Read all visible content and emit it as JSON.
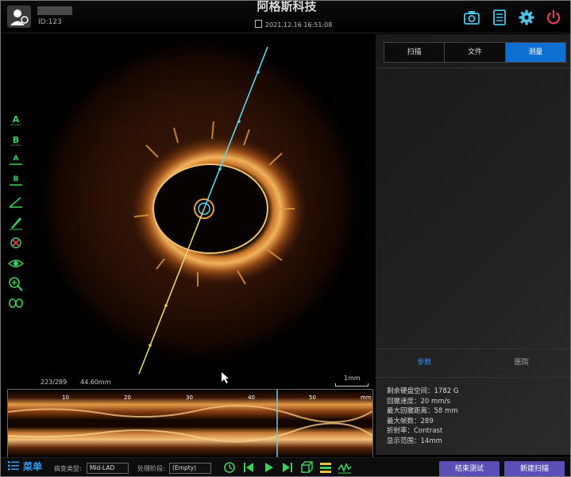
{
  "header": {
    "patient_id": "ID:123",
    "company": "阿格斯科技",
    "datetime": "2021.12.16 16:51:08",
    "icons": [
      "user-icon",
      "camera-icon",
      "report-icon",
      "gear-icon",
      "power-icon"
    ]
  },
  "image": {
    "frame_counter": "223/289",
    "distance": "44.60mm",
    "scale_label": "1mm"
  },
  "toolbar": {
    "icons": [
      "point-a-icon",
      "point-b-icon",
      "line-a-icon",
      "line-b-icon",
      "angle-icon",
      "pen-icon",
      "delete-icon",
      "eye-icon",
      "zoom-icon",
      "link-icon"
    ]
  },
  "longview": {
    "ticks": [
      "10",
      "20",
      "30",
      "40",
      "50",
      "mm"
    ]
  },
  "right_panel": {
    "tabs": [
      "扫描",
      "文件",
      "测量"
    ],
    "active_tab": "测量",
    "subtabs": [
      "参数",
      "医院"
    ],
    "active_subtab": "参数",
    "params": [
      "剩余硬盘空间：1782 G",
      "回撤速度：20 mm/s",
      "最大回撤距离：58 mm",
      "最大帧数：289",
      "折射率：Contrast",
      "显示范围：14mm"
    ]
  },
  "bottom": {
    "menu_label": "菜单",
    "vessel_type_label": "病变类型:",
    "vessel_type_value": "Mid-LAD",
    "stage_label": "处理阶段:",
    "stage_value": "(Empty)",
    "end_button": "结束测试",
    "new_scan_button": "新建扫描"
  },
  "colors": {
    "accent_blue": "#0c6fd1",
    "cyan_line": "#5fd4e6",
    "yellow_line": "#e8d36a",
    "button_purple": "#5a4fb5",
    "tool_green": "#3ccf5a"
  }
}
